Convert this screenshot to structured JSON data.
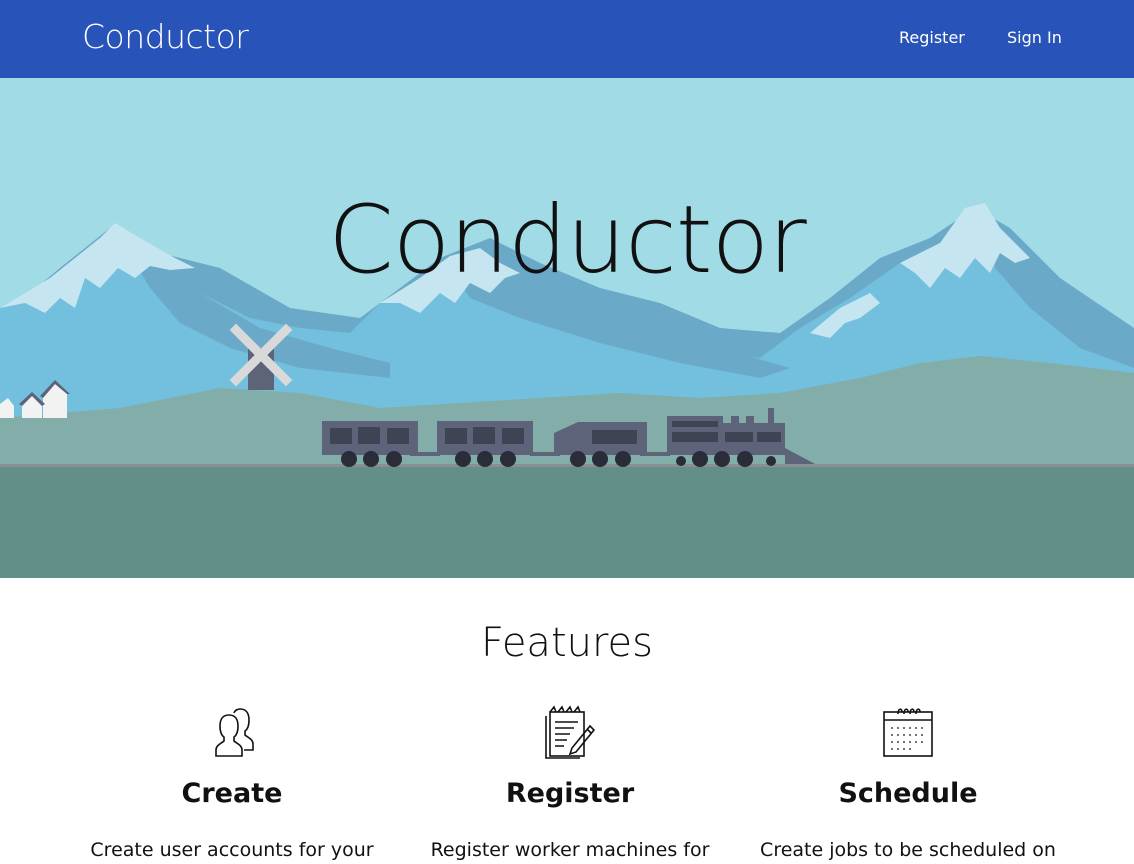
{
  "navbar": {
    "brand": "Conductor",
    "links": [
      {
        "label": "Register"
      },
      {
        "label": "Sign In"
      }
    ]
  },
  "hero": {
    "title": "Conductor",
    "colors": {
      "sky": "#a1dbe6",
      "mountain_back": "#6ba9c9",
      "mountain_front": "#72c0dd",
      "snow": "#c5e6f0",
      "hills": "#82ada8",
      "ground": "#628f88",
      "train": "#5d6379",
      "wheels": "#2a2c38"
    }
  },
  "features": {
    "title": "Features",
    "items": [
      {
        "icon": "users-icon",
        "heading": "Create",
        "text": "Create user accounts for your"
      },
      {
        "icon": "document-pen-icon",
        "heading": "Register",
        "text": "Register worker machines for"
      },
      {
        "icon": "calendar-icon",
        "heading": "Schedule",
        "text": "Create jobs to be scheduled on"
      }
    ]
  }
}
